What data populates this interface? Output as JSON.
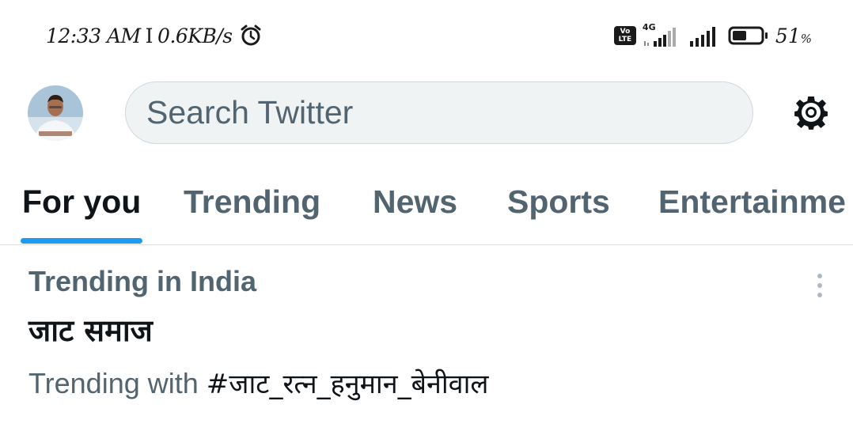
{
  "status_bar": {
    "time": "12:33 AM",
    "separator": "I",
    "net_speed": "0.6KB/s",
    "net_type": "4G",
    "volte": "Vo LTE",
    "battery_percent": "51",
    "battery_unit": "%",
    "battery_level": 0.51,
    "icons": [
      "alarm-icon",
      "volte-icon",
      "signal-icon",
      "signal-icon",
      "battery-icon"
    ]
  },
  "header": {
    "search_placeholder": "Search Twitter",
    "icons": [
      "avatar",
      "gear-icon"
    ]
  },
  "tabs": [
    {
      "label": "For you",
      "active": true
    },
    {
      "label": "Trending",
      "active": false
    },
    {
      "label": "News",
      "active": false
    },
    {
      "label": "Sports",
      "active": false
    },
    {
      "label": "Entertainme",
      "active": false
    }
  ],
  "trend": {
    "context": "Trending in India",
    "title": "जाट समाज",
    "meta_prefix": "Trending with ",
    "hashtag": "#जाट_रत्न_हनुमान_बेनीवाल"
  },
  "colors": {
    "accent": "#1d9bf0",
    "text_primary": "#0f1419",
    "text_secondary": "#536471",
    "search_bg": "#eff3f4"
  }
}
